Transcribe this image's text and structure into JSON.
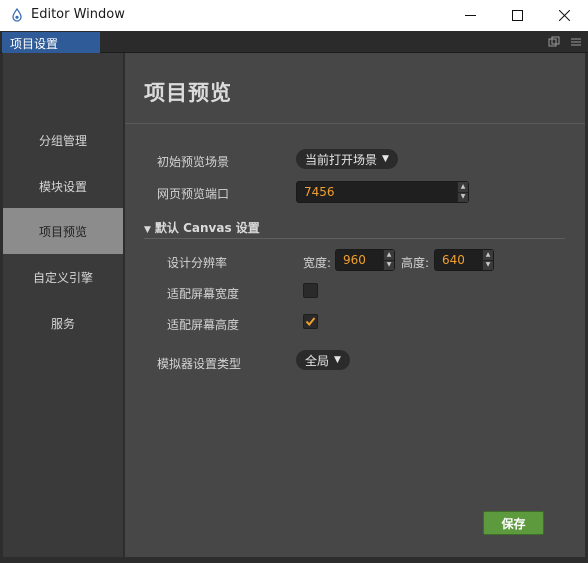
{
  "window": {
    "title": "Editor Window",
    "controls": [
      "minimize-icon",
      "maximize-icon",
      "close-icon"
    ]
  },
  "dock": {
    "tab_label": "项目设置",
    "icons": [
      "popout-icon",
      "menu-icon"
    ]
  },
  "sidebar": {
    "items": [
      {
        "label": "分组管理",
        "active": false
      },
      {
        "label": "模块设置",
        "active": false
      },
      {
        "label": "项目预览",
        "active": true
      },
      {
        "label": "自定义引擎",
        "active": false
      },
      {
        "label": "服务",
        "active": false
      }
    ]
  },
  "main": {
    "title": "项目预览",
    "initial_scene": {
      "label": "初始预览场景",
      "value": "当前打开场景"
    },
    "web_port": {
      "label": "网页预览端口",
      "value": "7456"
    },
    "canvas_section": {
      "header": "默认 Canvas 设置",
      "resolution": {
        "label": "设计分辨率",
        "width_label": "宽度:",
        "width_value": "960",
        "height_label": "高度:",
        "height_value": "640"
      },
      "fit_width": {
        "label": "适配屏幕宽度",
        "checked": false
      },
      "fit_height": {
        "label": "适配屏幕高度",
        "checked": true
      }
    },
    "simulator_type": {
      "label": "模拟器设置类型",
      "value": "全局"
    },
    "save_label": "保存"
  },
  "colors": {
    "accent_tab": "#2f5c98",
    "active_nav": "#8c8c8c",
    "number_text": "#f0a030",
    "checkbox_check": "#f0a030",
    "save_button": "#5d9a3e"
  }
}
